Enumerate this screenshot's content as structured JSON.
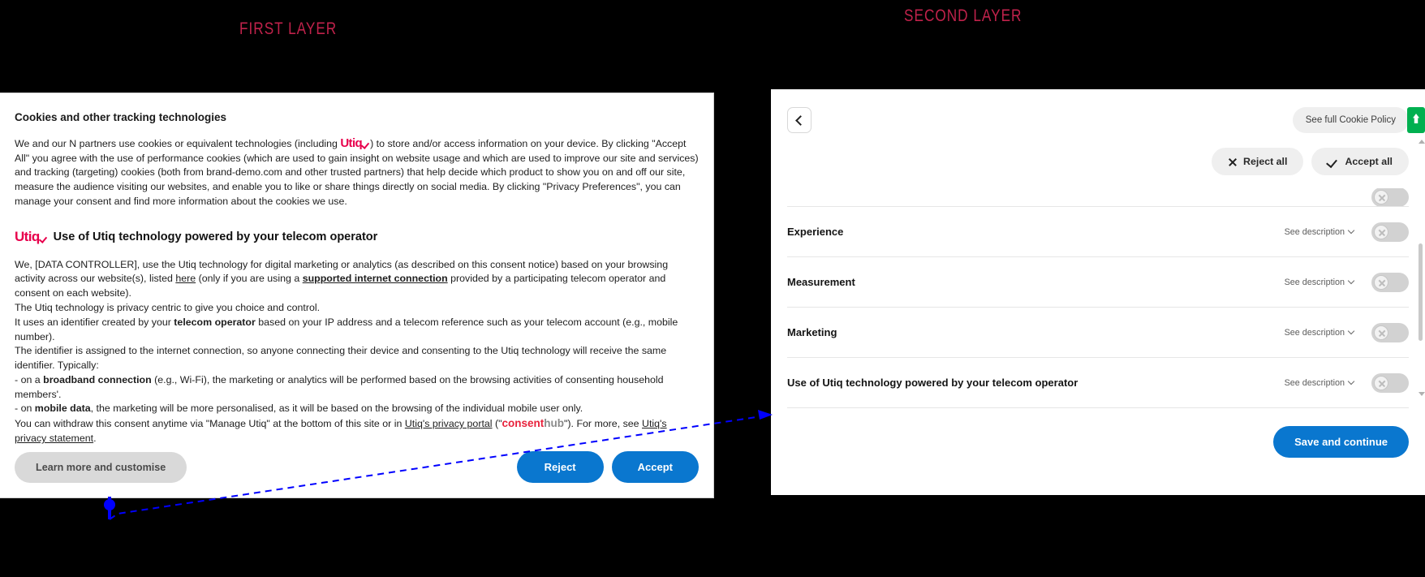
{
  "captions": {
    "first": "FIRST LAYER",
    "second": "SECOND LAYER",
    "color": "#c0224b"
  },
  "first_layer": {
    "title": "Cookies and other tracking technologies",
    "intro_paragraph": {
      "part1": "We and our N partners use cookies or equivalent technologies (including ",
      "logo": "Utiq",
      "part2": ") to store and/or access information on your device. By clicking \"Accept All\" you agree with the use of performance cookies (which are used to gain insight on website usage and which are used to improve our site and services) and tracking (targeting) cookies (both from brand-demo.com and other trusted partners) that help decide which product to show you on and off our site, measure the audience visiting our websites, and enable you to like or share things directly on social media. By clicking \"Privacy Preferences\", you can manage your consent and find more information about the cookies we use."
    },
    "section_heading": "Use of Utiq technology powered by your telecom operator",
    "section_logo": "Utiq",
    "paragraphs": [
      {
        "id": "p-controller",
        "segments": [
          {
            "text": "We, [DATA CONTROLLER], use the Utiq technology for digital marketing or analytics (as described on this consent notice) based on your browsing activity across our website(s), listed ",
            "style": "normal"
          },
          {
            "text": "here",
            "style": "underline"
          },
          {
            "text": " (only if you are using a ",
            "style": "normal"
          },
          {
            "text": "supported internet connection",
            "style": "bold-underline"
          },
          {
            "text": " provided by a participating telecom operator and consent on each website).",
            "style": "normal"
          }
        ]
      },
      {
        "id": "p-privacy-centric",
        "segments": [
          {
            "text": "The Utiq technology is privacy centric to give you choice and control.",
            "style": "normal"
          }
        ]
      },
      {
        "id": "p-identifier",
        "segments": [
          {
            "text": "It uses an identifier created by your ",
            "style": "normal"
          },
          {
            "text": "telecom operator",
            "style": "bold"
          },
          {
            "text": " based on your IP address and a telecom reference such as your telecom account (e.g., mobile number).",
            "style": "normal"
          }
        ]
      },
      {
        "id": "p-assignment",
        "segments": [
          {
            "text": "The identifier is assigned to the internet connection, so anyone connecting their device and consenting to the Utiq technology will receive the same identifier. Typically:",
            "style": "normal"
          }
        ]
      },
      {
        "id": "p-broadband",
        "segments": [
          {
            "text": "- on a ",
            "style": "normal"
          },
          {
            "text": "broadband connection",
            "style": "bold"
          },
          {
            "text": " (e.g., Wi-Fi), the marketing or analytics will be performed based on the browsing activities of consenting household members'.",
            "style": "normal"
          }
        ]
      },
      {
        "id": "p-mobile",
        "segments": [
          {
            "text": "- on ",
            "style": "normal"
          },
          {
            "text": "mobile data",
            "style": "bold"
          },
          {
            "text": ", the marketing will be more personalised, as it will be based on the browsing of the individual mobile user only.",
            "style": "normal"
          }
        ]
      }
    ],
    "withdraw_paragraph": {
      "before_portal": "You can withdraw this consent anytime via \"Manage Utiq\" at the bottom of this site or in ",
      "portal_link": "Utiq's privacy portal",
      "after_portal": " (\"",
      "brand_part1": "consent",
      "brand_part2": "hub",
      "after_brand": "\"). For more, see ",
      "statement_link": "Utiq's privacy statement",
      "period": "."
    },
    "buttons": {
      "learn_more": "Learn more and customise",
      "reject": "Reject",
      "accept": "Accept",
      "blue": "#0a77cf",
      "gray": "#d9d9d9"
    }
  },
  "second_layer": {
    "back_icon": "chevron-left-icon",
    "policy_button": "See full Cookie Policy",
    "badge_icon": "upload-badge-icon",
    "badge_color": "#00b050",
    "bulk_actions": {
      "reject_all": "Reject all",
      "accept_all": "Accept all"
    },
    "see_description_label": "See description",
    "categories": [
      {
        "label": "",
        "partial": true,
        "toggle": "off"
      },
      {
        "label": "Experience",
        "partial": false,
        "toggle": "off"
      },
      {
        "label": "Measurement",
        "partial": false,
        "toggle": "off"
      },
      {
        "label": "Marketing",
        "partial": false,
        "toggle": "off"
      },
      {
        "label": "Use of Utiq technology powered by your telecom operator",
        "partial": false,
        "toggle": "off"
      }
    ],
    "save_button": "Save and continue",
    "accent": "#0a77cf"
  },
  "connector": {
    "style": "dashed-arrow",
    "color": "#0000ff"
  }
}
